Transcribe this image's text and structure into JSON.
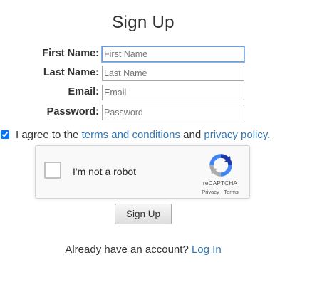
{
  "title": "Sign Up",
  "fields": {
    "first_name": {
      "label": "First Name:",
      "placeholder": "First Name",
      "value": ""
    },
    "last_name": {
      "label": "Last Name:",
      "placeholder": "Last Name",
      "value": ""
    },
    "email": {
      "label": "Email:",
      "placeholder": "Email",
      "value": ""
    },
    "password": {
      "label": "Password:",
      "placeholder": "Password",
      "value": ""
    }
  },
  "agree": {
    "checked": true,
    "prefix": "I agree to the ",
    "terms_link": "terms and conditions",
    "middle": " and ",
    "privacy_link": "privacy policy",
    "suffix": "."
  },
  "captcha": {
    "label": "I'm not a robot",
    "brand": "reCAPTCHA",
    "links": "Privacy - Terms",
    "icon": "recaptcha-logo-icon"
  },
  "submit_label": "Sign Up",
  "login": {
    "prompt": "Already have an account? ",
    "link": "Log In"
  },
  "colors": {
    "link": "#3277b6",
    "text": "#333333",
    "focus_border": "#6d9ad8"
  }
}
